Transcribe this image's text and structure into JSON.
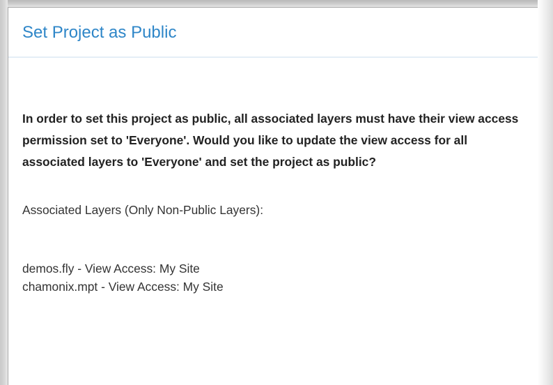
{
  "dialog": {
    "title": "Set Project as Public",
    "message": "In order to set this project as public, all associated layers must have their view access permission set to 'Everyone'. Would you like to update the view access for all associated layers to 'Everyone' and set the project as public?",
    "layers_heading": "Associated Layers (Only Non-Public Layers):",
    "layers": [
      "demos.fly - View Access: My Site",
      "chamonix.mpt - View Access: My Site"
    ]
  },
  "colors": {
    "title": "#2e86c8",
    "header_divider": "#e4eef6",
    "body_text": "#333333",
    "warning_text": "#222222"
  }
}
